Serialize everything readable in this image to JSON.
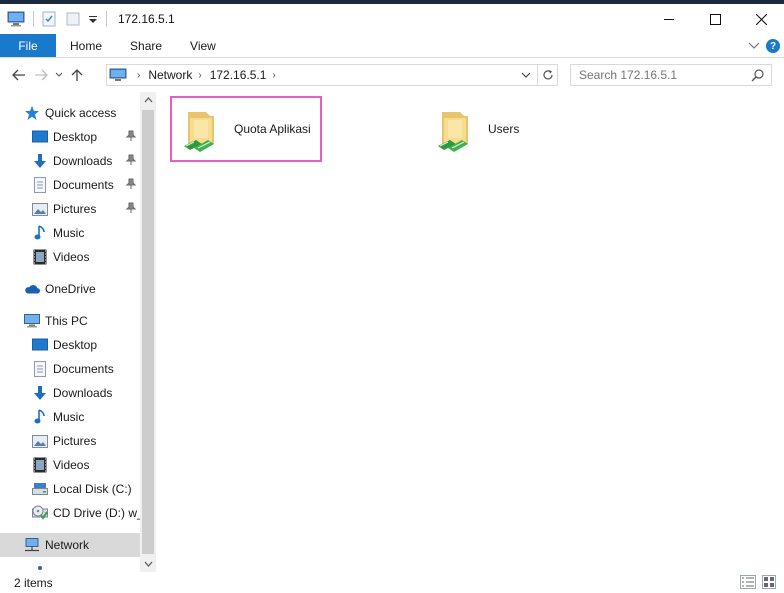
{
  "window": {
    "title": "172.16.5.1"
  },
  "ribbon": {
    "tabs": [
      "File",
      "Home",
      "Share",
      "View"
    ]
  },
  "address": {
    "crumbs": [
      "Network",
      "172.16.5.1"
    ]
  },
  "search": {
    "placeholder": "Search 172.16.5.1"
  },
  "nav": {
    "items": [
      {
        "label": "Quick access",
        "icon": "star-icon"
      },
      {
        "label": "Desktop",
        "icon": "desktop-icon",
        "pinned": true
      },
      {
        "label": "Downloads",
        "icon": "download-icon",
        "pinned": true
      },
      {
        "label": "Documents",
        "icon": "document-icon",
        "pinned": true
      },
      {
        "label": "Pictures",
        "icon": "pictures-icon",
        "pinned": true
      },
      {
        "label": "Music",
        "icon": "music-icon"
      },
      {
        "label": "Videos",
        "icon": "video-icon"
      },
      {
        "label": "OneDrive",
        "icon": "cloud-icon"
      },
      {
        "label": "This PC",
        "icon": "computer-icon"
      },
      {
        "label": "Desktop",
        "icon": "desktop-icon"
      },
      {
        "label": "Documents",
        "icon": "document-icon"
      },
      {
        "label": "Downloads",
        "icon": "download-icon"
      },
      {
        "label": "Music",
        "icon": "music-icon"
      },
      {
        "label": "Pictures",
        "icon": "pictures-icon"
      },
      {
        "label": "Videos",
        "icon": "video-icon"
      },
      {
        "label": "Local Disk (C:)",
        "icon": "drive-icon"
      },
      {
        "label": "CD Drive (D:) w_",
        "icon": "cd-drive-icon"
      },
      {
        "label": "Network",
        "icon": "network-icon"
      }
    ]
  },
  "content": {
    "items": [
      {
        "name": "Quota Aplikasi",
        "icon": "shared-folder-icon",
        "selected": true
      },
      {
        "name": "Users",
        "icon": "shared-folder-icon",
        "selected": false
      }
    ]
  },
  "status": {
    "item_count": "2 items"
  },
  "colors": {
    "file_tab": "#1979ca",
    "selection_outline": "#e85ec2",
    "nav_selected": "#d9d9d9"
  }
}
